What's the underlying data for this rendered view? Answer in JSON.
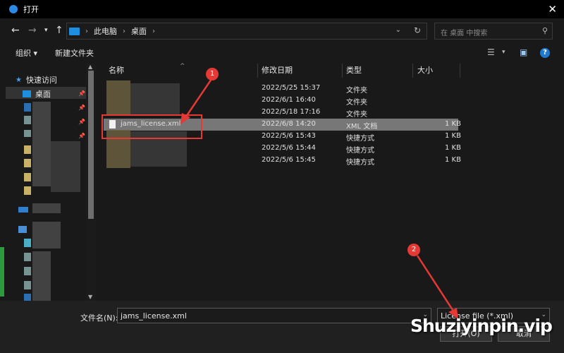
{
  "window": {
    "title": "打开"
  },
  "address": {
    "crumbs": [
      "此电脑",
      "桌面"
    ]
  },
  "search": {
    "placeholder": "在 桌面 中搜索"
  },
  "toolbar": {
    "organize": "组织 ▾",
    "new_folder": "新建文件夹"
  },
  "nav": {
    "quick_access": "快速访问",
    "desktop": "桌面"
  },
  "columns": {
    "name": "名称",
    "date": "修改日期",
    "type": "类型",
    "size": "大小"
  },
  "files": [
    {
      "name": "",
      "date": "2022/5/25 15:37",
      "type": "文件夹",
      "size": ""
    },
    {
      "name": "",
      "date": "2022/6/1 16:40",
      "type": "文件夹",
      "size": ""
    },
    {
      "name": "",
      "date": "2022/5/18 17:16",
      "type": "文件夹",
      "size": ""
    },
    {
      "name": "jams_license.xml",
      "date": "2022/6/8 14:20",
      "type": "XML 文档",
      "size": "1 KB"
    },
    {
      "name": "",
      "date": "2022/5/6 15:43",
      "type": "快捷方式",
      "size": "1 KB"
    },
    {
      "name": "",
      "date": "2022/5/6 15:44",
      "type": "快捷方式",
      "size": "1 KB"
    },
    {
      "name": "",
      "date": "2022/5/6 15:45",
      "type": "快捷方式",
      "size": "1 KB"
    }
  ],
  "bottom": {
    "filename_label": "文件名(N):",
    "filename_value": "jams_license.xml",
    "filter_value": "License file (*.xml)",
    "open_button": "打开(O)",
    "cancel_button": "取消"
  },
  "annotations": {
    "badge1": "1",
    "badge2": "2"
  },
  "watermark": "Shuziyinpin.vip",
  "colors": {
    "accent": "#2b8ae8",
    "annotation": "#e53935",
    "selection": "#777777"
  }
}
